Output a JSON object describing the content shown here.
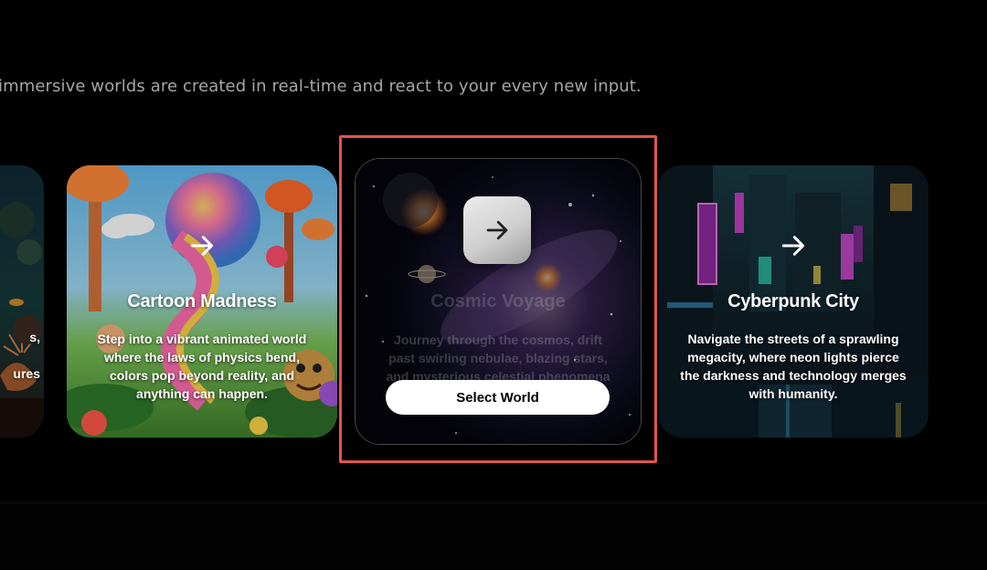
{
  "header": {
    "subtitle": "immersive worlds are created in real-time and react to your every new input."
  },
  "cards": {
    "partial": {
      "text_lines": [
        "s,",
        "ures"
      ]
    },
    "cartoon": {
      "title": "Cartoon Madness",
      "description": "Step into a vibrant animated world where the laws of physics bend, colors pop beyond reality, and anything can happen.",
      "icon": "arrow-right-icon"
    },
    "cosmic": {
      "title": "Cosmic Voyage",
      "description": "Journey through the cosmos, drift past swirling nebulae, blazing stars, and mysterious celestial phenomena",
      "button_label": "Select World",
      "icon": "arrow-right-icon"
    },
    "cyber": {
      "title": "Cyberpunk City",
      "description": "Navigate the streets of a sprawling megacity, where neon lights pierce the darkness and technology merges with humanity.",
      "icon": "arrow-right-icon"
    }
  },
  "colors": {
    "background": "#000000",
    "highlight": "#e5534b",
    "button_bg": "#ffffff"
  }
}
